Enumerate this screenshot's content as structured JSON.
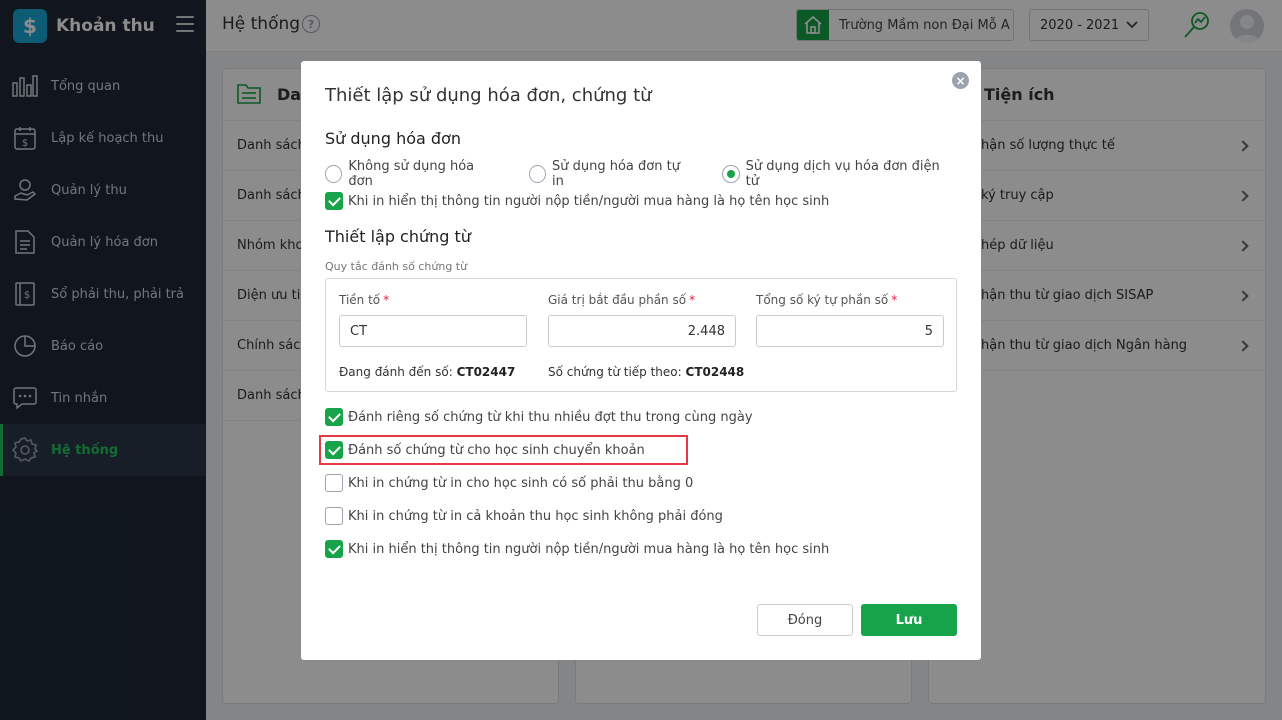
{
  "sidebar": {
    "brand": "Khoản thu",
    "brand_logo": "$",
    "items": [
      {
        "label": "Tổng quan",
        "icon": "bar-chart-icon"
      },
      {
        "label": "Lập kế hoạch thu",
        "icon": "calendar-dollar-icon"
      },
      {
        "label": "Quản lý thu",
        "icon": "hand-coin-icon"
      },
      {
        "label": "Quản lý hóa đơn",
        "icon": "document-icon"
      },
      {
        "label": "Sổ phải thu, phải trả",
        "icon": "ledger-book-icon"
      },
      {
        "label": "Báo cáo",
        "icon": "pie-chart-icon"
      },
      {
        "label": "Tin nhắn",
        "icon": "message-icon"
      },
      {
        "label": "Hệ thống",
        "icon": "gear-icon",
        "active": true
      }
    ]
  },
  "header": {
    "title": "Hệ thống",
    "help": "?",
    "school": "Trường Mầm non Đại Mỗ A",
    "year": "2020 - 2021"
  },
  "panels": {
    "left_title": "Danh mục",
    "left_rows": [
      "Danh sách",
      "Danh sách",
      "Nhóm kho",
      "Diện ưu tiê",
      "Chính sách",
      "Danh sách"
    ],
    "right_title": "Tiện ích",
    "right_rows": [
      "hận số lượng thực tế",
      "ký truy cập",
      "hép dữ liệu",
      "hận thu từ giao dịch SISAP",
      "hận thu từ giao dịch Ngân hàng"
    ]
  },
  "modal": {
    "title": "Thiết lập sử dụng hóa đơn, chứng từ",
    "close": "×",
    "invoice_section": "Sử dụng hóa đơn",
    "radios": [
      {
        "label": "Không sử dụng hóa đơn",
        "checked": false
      },
      {
        "label": "Sử dụng hóa đơn tự in",
        "checked": false
      },
      {
        "label": "Sử dụng dịch vụ hóa đơn điện tử",
        "checked": true
      }
    ],
    "invoice_check": "Khi in hiển thị thông tin người nộp tiền/người mua hàng là họ tên học sinh",
    "voucher_section": "Thiết lập chứng từ",
    "rule_hint": "Quy tắc đánh số chứng từ",
    "fields": {
      "prefix_label": "Tiền tố",
      "prefix_value": "CT",
      "start_label": "Giá trị bắt đầu phần số",
      "start_value": "2.448",
      "length_label": "Tổng số ký tự phần số",
      "length_value": "5",
      "required_mark": "*"
    },
    "current_label": "Đang đánh đến số:",
    "current_value": "CT02447",
    "next_label": "Số chứng từ tiếp theo:",
    "next_value": "CT02448",
    "checks": [
      {
        "label": "Đánh riêng số chứng từ khi thu nhiều đợt thu trong cùng ngày",
        "checked": true
      },
      {
        "label": "Đánh số chứng từ cho học sinh chuyển khoản",
        "checked": true
      },
      {
        "label": "Khi in chứng từ in cho học sinh có số phải thu bằng 0",
        "checked": false
      },
      {
        "label": "Khi in chứng từ in cả khoản thu học sinh không phải đóng",
        "checked": false
      },
      {
        "label": "Khi in hiển thị thông tin người nộp tiền/người mua hàng là họ tên học sinh",
        "checked": true
      }
    ],
    "btn_close": "Đóng",
    "btn_save": "Lưu"
  },
  "colors": {
    "accent": "#16a34a",
    "sidebar_bg": "#1f2937",
    "highlight": "#e53945"
  }
}
